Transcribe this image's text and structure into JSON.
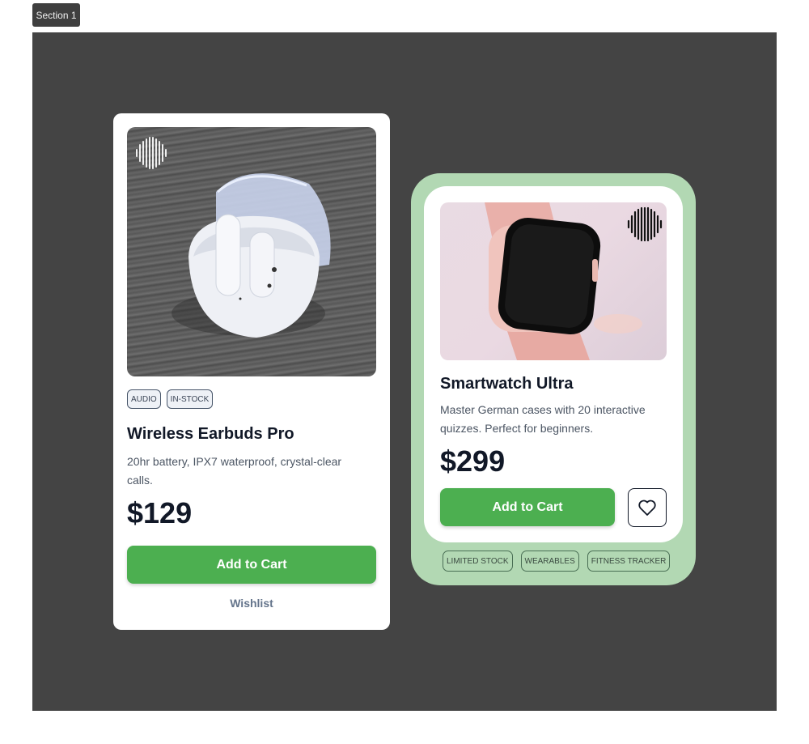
{
  "section_label": "Section 1",
  "colors": {
    "canvas": "#444444",
    "accent_green": "#4caf50",
    "card2_frame": "#b2d8b3"
  },
  "products": [
    {
      "tags": [
        "AUDIO",
        "IN-STOCK"
      ],
      "title": "Wireless Earbuds Pro",
      "description": "20hr battery, IPX7 waterproof, crystal-clear calls.",
      "price": "$129",
      "primary_button": "Add to Cart",
      "secondary_link": "Wishlist",
      "image": "white wireless earbuds in open charging case on dark wood",
      "badge_icon": "soundwave-icon"
    },
    {
      "title": "Smartwatch Ultra",
      "description": "Master German cases with 20 interactive quizzes. Perfect for beginners.",
      "price": "$299",
      "primary_button": "Add to Cart",
      "favorite_icon": "heart-icon",
      "tags": [
        "LIMITED STOCK",
        "WEARABLES",
        "FITNESS TRACKER"
      ],
      "image": "pink smartwatch on light pink background",
      "badge_icon": "soundwave-icon"
    }
  ]
}
